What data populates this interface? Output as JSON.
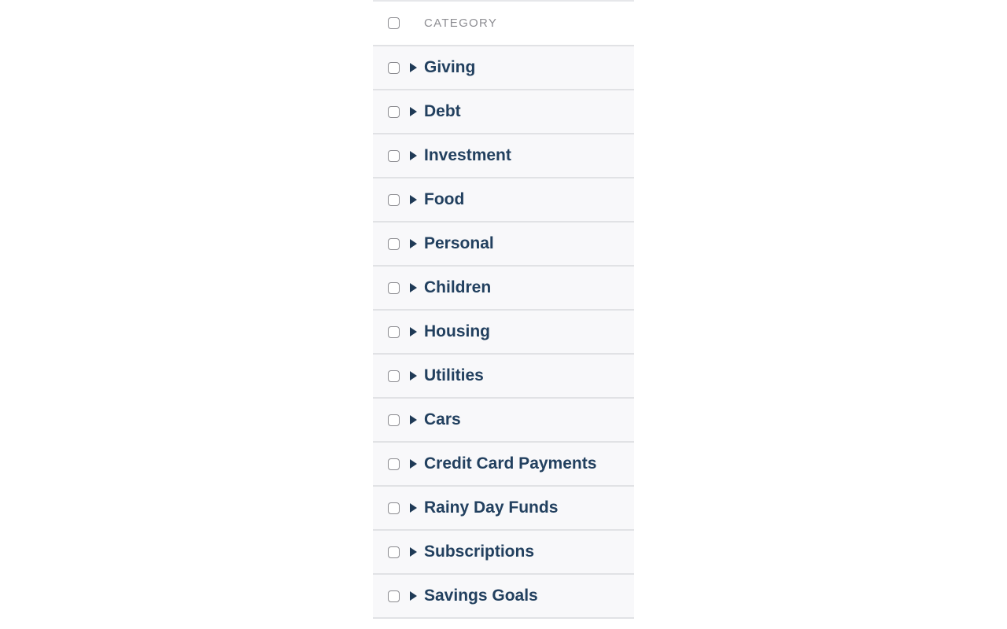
{
  "table": {
    "header": {
      "label": "CATEGORY"
    },
    "rows": [
      {
        "label": "Giving"
      },
      {
        "label": "Debt"
      },
      {
        "label": "Investment"
      },
      {
        "label": "Food"
      },
      {
        "label": "Personal"
      },
      {
        "label": "Children"
      },
      {
        "label": "Housing"
      },
      {
        "label": "Utilities"
      },
      {
        "label": "Cars"
      },
      {
        "label": "Credit Card Payments"
      },
      {
        "label": "Rainy Day Funds"
      },
      {
        "label": "Subscriptions"
      },
      {
        "label": "Savings Goals"
      }
    ]
  }
}
